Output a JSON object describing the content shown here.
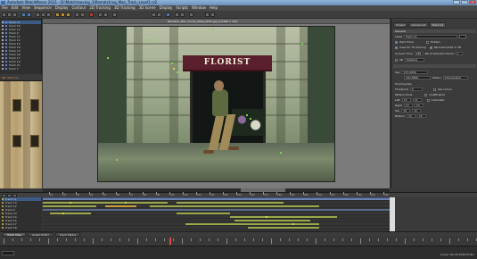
{
  "window": {
    "title": "Autodesk MatchMover 2011 - D:\\Matchmoving_1\\Rematching_Man_Track_Level1.rz2",
    "minimize": "_",
    "maximize": "□",
    "close": "x"
  },
  "menu": [
    "File",
    "Edit",
    "View",
    "Sequence",
    "Display",
    "Contour",
    "2D Tracking",
    "3D Tracking",
    "3D Scene",
    "Display",
    "Scripts",
    "Window",
    "Help"
  ],
  "left_tracks": [
    {
      "label": "Track 11"
    },
    {
      "label": "Track 10"
    },
    {
      "label": "Track 12"
    },
    {
      "label": "Track 9"
    },
    {
      "label": "Track 17"
    },
    {
      "label": "Track 14"
    },
    {
      "label": "Track 15"
    },
    {
      "label": "Track 16"
    },
    {
      "label": "Track 13"
    },
    {
      "label": "Track 18"
    },
    {
      "label": "Track 17"
    },
    {
      "label": "Track 19"
    },
    {
      "label": "Track 21"
    },
    {
      "label": "Track 7"
    }
  ],
  "left_header": "4D: Track 11",
  "viewer": {
    "title": "Rematch_Man_frame_9999_0845.jpg (1/1280 x 720)"
  },
  "scene": {
    "sign": "FLORIST"
  },
  "right_panel": {
    "tabs": [
      "Project",
      "Camera 01",
      "Track 11"
    ],
    "general_section": "General",
    "label_caption": "Label",
    "label_value": "Track 11",
    "opts": [
      {
        "label": "Hard Track",
        "checked": true
      },
      {
        "label": "Used for 3D Solving",
        "checked": true
      },
      {
        "label": "Hidden",
        "checked": false
      },
      {
        "label": "Reconstructed in 3D",
        "checked": true
      }
    ],
    "current_caption": "Current Time",
    "current_value": "188",
    "selected_caption": "Nb of Selected Tracks",
    "selected_value": "1",
    "rows": [
      {
        "label": "2D",
        "value": "Relative"
      },
      {
        "label": "Key",
        "value": "272.0000"
      },
      {
        "label": "",
        "value": "242.8800"
      },
      {
        "label": "Tracking Key",
        "value": ""
      },
      {
        "label": "Threshold",
        "value": "0"
      },
      {
        "label": "Pattern Zone",
        "value": "Search Zone"
      },
      {
        "label": "Left",
        "value": "15"
      },
      {
        "label": "Right",
        "value": "15"
      },
      {
        "label": "Top",
        "value": "15"
      },
      {
        "label": "Bottom",
        "value": "15"
      }
    ],
    "status_label": "Status",
    "status_value": "Interpolated",
    "use_colors": "Use Colors",
    "confidence": "Coefficients",
    "automatic": "Automatic"
  },
  "tl_tracks": [
    {
      "label": "Track 11"
    },
    {
      "label": "Track 10"
    },
    {
      "label": "Track 12"
    },
    {
      "label": "Track 9"
    },
    {
      "label": "Track 13"
    },
    {
      "label": "Track 14"
    },
    {
      "label": "Track 15"
    },
    {
      "label": "Track 17"
    },
    {
      "label": "Track 18"
    }
  ],
  "timeline_numbers": [
    "10",
    "20",
    "30",
    "40",
    "50",
    "60",
    "70",
    "80",
    "90",
    "100",
    "110",
    "120",
    "130",
    "140",
    "150",
    "160",
    "170",
    "180",
    "190",
    "200",
    "210",
    "220",
    "230",
    "240",
    "250",
    "260"
  ],
  "tl_tabs": [
    "Track View",
    "Graph Editor",
    "Track Status"
  ],
  "status": {
    "text": "Cursor 3D 24.0539 M Min"
  },
  "colors": {
    "accent": "#c08a2a",
    "selection": "#3c5a85",
    "track_green": "#7ad84a",
    "key_yellow": "#e8d040",
    "awning": "#5a1f2c"
  }
}
